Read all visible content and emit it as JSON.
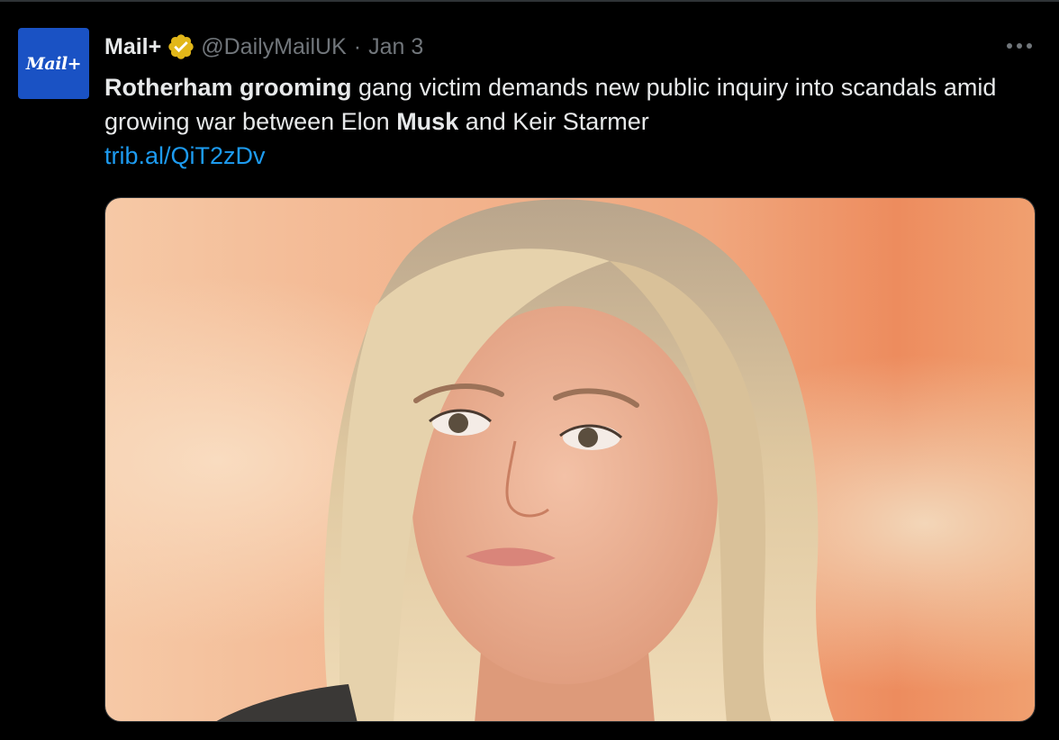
{
  "tweet": {
    "avatar": {
      "logo_text": "Mail+",
      "color": "#1a52c4"
    },
    "author": {
      "display_name": "Mail+",
      "verified_badge": "gold-verified-badge-icon",
      "handle": "@DailyMailUK",
      "separator": "·",
      "date": "Jan 3"
    },
    "more_icon": "more-horizontal-icon",
    "text": {
      "bold1": "Rotherham grooming",
      "part1": " gang victim demands new public inquiry into scandals amid growing war between Elon ",
      "bold2": "Musk",
      "part2": " and Keir Starmer",
      "link": "trib.al/QiT2zDv"
    },
    "media": {
      "type": "photo",
      "subject": "portrait-photo"
    },
    "colors": {
      "background": "#000000",
      "text": "#e7e9ea",
      "secondary": "#71767b",
      "link": "#1d9bf0",
      "badge": "#e2b719"
    }
  }
}
